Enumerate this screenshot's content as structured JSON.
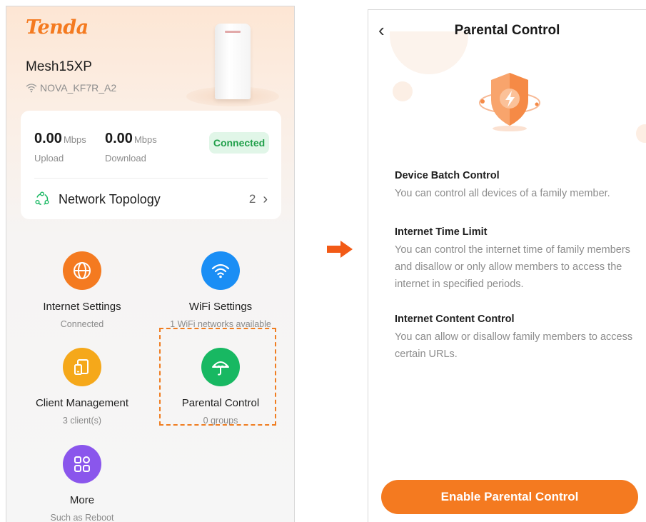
{
  "home": {
    "brand": "Tenda",
    "router_name": "Mesh15XP",
    "ssid": "NOVA_KF7R_A2",
    "upload_value": "0.00",
    "upload_unit": "Mbps",
    "upload_label": "Upload",
    "download_value": "0.00",
    "download_unit": "Mbps",
    "download_label": "Download",
    "status_badge": "Connected",
    "topology_label": "Network Topology",
    "topology_count": "2",
    "features": [
      {
        "title": "Internet Settings",
        "sub": "Connected",
        "icon": "globe-icon",
        "color": "#f47a20"
      },
      {
        "title": "WiFi Settings",
        "sub": "1 WiFi networks available",
        "icon": "wifi-icon",
        "color": "#1a8ef5"
      },
      {
        "title": "Client Management",
        "sub": "3 client(s)",
        "icon": "devices-icon",
        "color": "#f5a81a"
      },
      {
        "title": "Parental Control",
        "sub": "0 groups",
        "icon": "umbrella-icon",
        "color": "#18b862"
      },
      {
        "title": "More",
        "sub": "Such as Reboot",
        "icon": "grid-icon",
        "color": "#8a56ec"
      }
    ]
  },
  "parental": {
    "back_icon": "chevron-left-icon",
    "title": "Parental Control",
    "sections": [
      {
        "heading": "Device Batch Control",
        "desc": "You can control all devices of a family member."
      },
      {
        "heading": "Internet Time Limit",
        "desc": "You can control the internet time of family members and disallow or only allow members to access the internet in specified periods."
      },
      {
        "heading": "Internet Content Control",
        "desc": "You can allow or disallow family members to access certain URLs."
      }
    ],
    "enable_button": "Enable Parental Control"
  },
  "colors": {
    "accent": "#f47a20",
    "connected_green": "#22a04b",
    "highlight": "#f07d20"
  }
}
